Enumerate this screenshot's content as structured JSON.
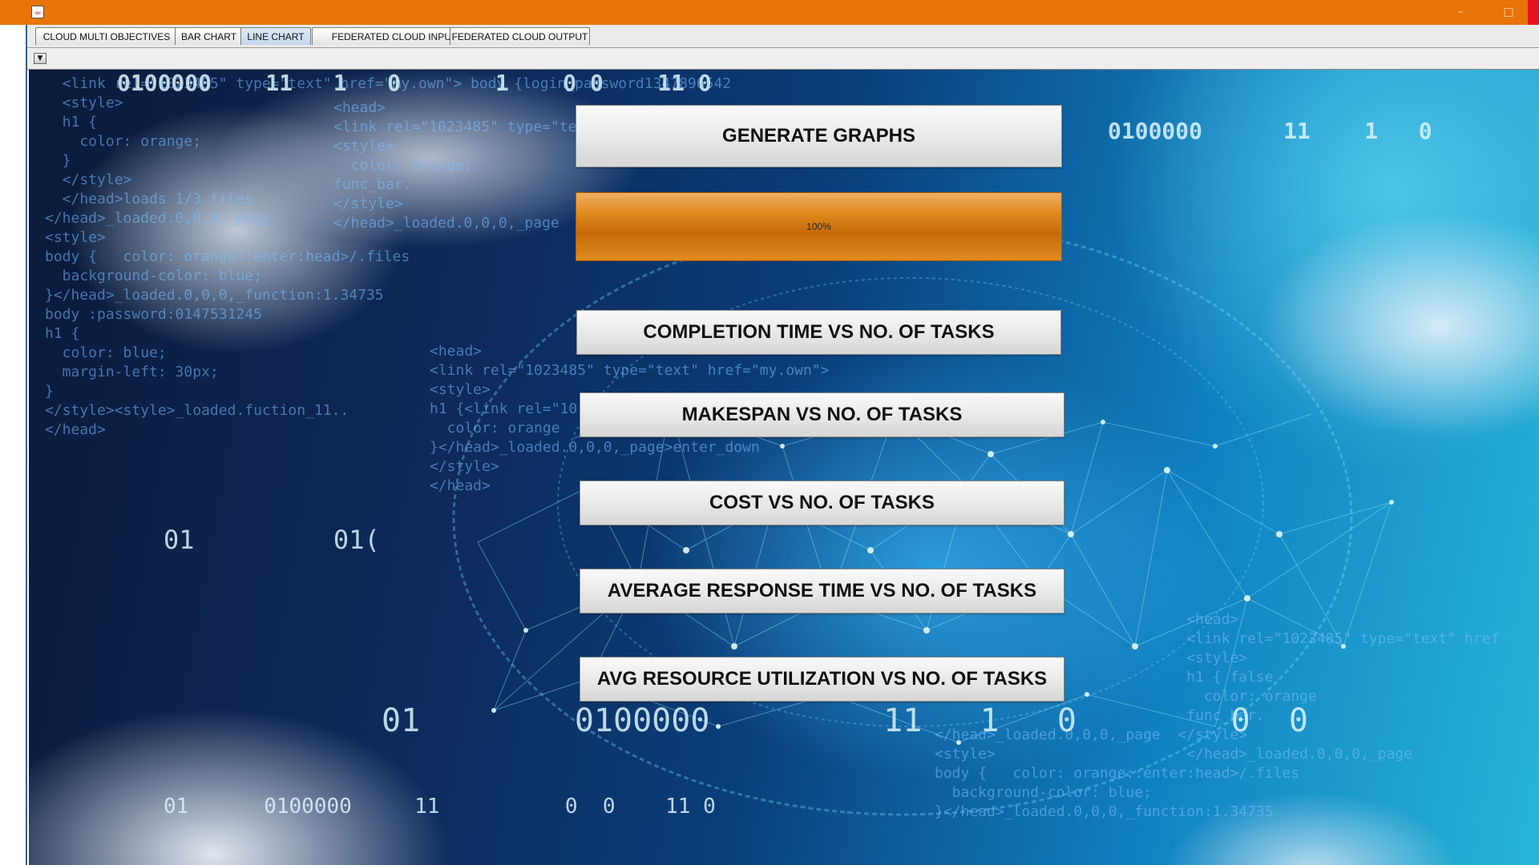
{
  "window": {
    "icon": "java-cup-icon",
    "title": ""
  },
  "tabs": [
    {
      "label": "CLOUD MULTI OBJECTIVES",
      "active": false
    },
    {
      "label": "BAR CHART",
      "active": false
    },
    {
      "label": "LINE CHART",
      "active": true
    },
    {
      "label": "FEDERATED CLOUD INPUT",
      "active": false
    },
    {
      "label": "FEDERATED CLOUD OUTPUT",
      "active": false
    }
  ],
  "progress": {
    "value_percent": 100,
    "label": "100%",
    "color": "#e08a20"
  },
  "buttons": {
    "generate": "GENERATE GRAPHS",
    "completion": "COMPLETION TIME VS NO. OF TASKS",
    "makespan": "MAKESPAN VS NO. OF TASKS",
    "cost": "COST VS NO. OF TASKS",
    "response": "AVERAGE RESPONSE TIME VS NO. OF TASKS",
    "utilization": "AVG RESOURCE UTILIZATION VS NO. OF TASKS"
  },
  "colors": {
    "titlebar": "#e8740a",
    "close": "#e81123"
  }
}
